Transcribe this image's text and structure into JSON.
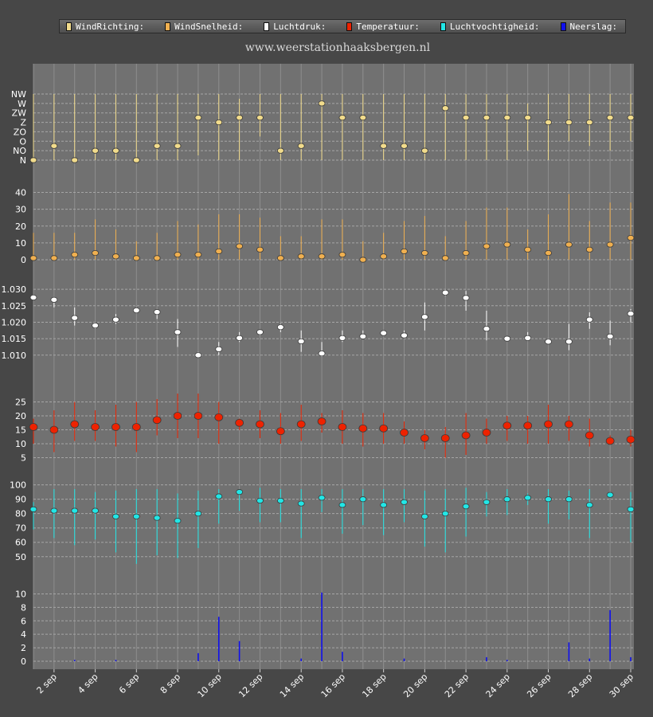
{
  "site_title": "www.weerstationhaaksbergen.nl",
  "legend": [
    {
      "label": "WindRichting:",
      "color": "#f2dc8c"
    },
    {
      "label": "WindSnelheid:",
      "color": "#f0b050"
    },
    {
      "label": "Luchtdruk:",
      "color": "#ffffff"
    },
    {
      "label": "Temperatuur:",
      "color": "#ee2200"
    },
    {
      "label": "Luchtvochtigheid:",
      "color": "#22e6e6"
    },
    {
      "label": "Neerslag:",
      "color": "#1010ee"
    }
  ],
  "chart_data": [
    {
      "type": "scatter",
      "name": "WindRichting",
      "color": "#f2dc8c",
      "days": [
        1,
        2,
        3,
        4,
        5,
        6,
        7,
        8,
        9,
        10,
        11,
        12,
        13,
        14,
        15,
        16,
        17,
        18,
        19,
        20,
        21,
        22,
        23,
        24,
        25,
        26,
        27,
        28,
        29,
        30
      ],
      "yticks": [
        "N",
        "NO",
        "O",
        "ZO",
        "Z",
        "ZW",
        "W",
        "NW"
      ],
      "ylim": [
        0,
        7
      ],
      "values": [
        0,
        1.5,
        0,
        1,
        1,
        0,
        1.5,
        1.5,
        4.5,
        4,
        4.5,
        4.5,
        1,
        1.5,
        6,
        4.5,
        4.5,
        1.5,
        1.5,
        1,
        5.5,
        4.5,
        4.5,
        4.5,
        4.5,
        4,
        4,
        4,
        4.5,
        4.5
      ],
      "low": [
        0,
        0,
        0,
        0,
        0,
        0,
        0,
        0,
        0.5,
        0,
        0,
        2.5,
        0,
        0,
        0,
        0,
        0,
        0,
        0,
        0,
        0,
        0,
        0,
        0,
        1,
        0,
        2,
        1.5,
        1,
        2
      ],
      "high": [
        8,
        8,
        8,
        8,
        8,
        8,
        8,
        8,
        8,
        8,
        6.5,
        8,
        8,
        8,
        8,
        8,
        8,
        8,
        8,
        8,
        8,
        7.5,
        8,
        8,
        6,
        8,
        8,
        8,
        8,
        7
      ]
    },
    {
      "type": "scatter",
      "name": "WindSnelheid",
      "color": "#f0b050",
      "days": [
        1,
        2,
        3,
        4,
        5,
        6,
        7,
        8,
        9,
        10,
        11,
        12,
        13,
        14,
        15,
        16,
        17,
        18,
        19,
        20,
        21,
        22,
        23,
        24,
        25,
        26,
        27,
        28,
        29,
        30
      ],
      "yticks": [
        0,
        10,
        20,
        30,
        40
      ],
      "ylim": [
        0,
        45
      ],
      "values": [
        1,
        1,
        3,
        4,
        2,
        1,
        1,
        3,
        3,
        5,
        8,
        6,
        1,
        2,
        2,
        3,
        0,
        2,
        5,
        4,
        1,
        4,
        8,
        9,
        6,
        4,
        9,
        6,
        9,
        13
      ],
      "low": [
        0,
        0,
        0,
        0,
        0,
        0,
        0,
        0,
        0,
        0,
        0,
        0,
        0,
        0,
        0,
        0,
        0,
        0,
        0,
        0,
        0,
        0,
        0,
        0,
        0,
        0,
        0,
        0,
        0,
        0
      ],
      "high": [
        16,
        16,
        16,
        24,
        18,
        11,
        16,
        23,
        21,
        27,
        27,
        25,
        14,
        14,
        24,
        24,
        11,
        16,
        23,
        26,
        14,
        23,
        31,
        31,
        18,
        27,
        39,
        23,
        34,
        34
      ]
    },
    {
      "type": "scatter",
      "name": "Luchtdruk",
      "color": "#ffffff",
      "days": [
        1,
        2,
        3,
        4,
        5,
        6,
        7,
        8,
        9,
        10,
        11,
        12,
        13,
        14,
        15,
        16,
        17,
        18,
        19,
        20,
        21,
        22,
        23,
        24,
        25,
        26,
        27,
        28,
        29,
        30
      ],
      "yticks": [
        1.01,
        1.015,
        1.02,
        1.025,
        1.03
      ],
      "ylim": [
        1.0085,
        1.031
      ],
      "values": [
        1.0275,
        1.0268,
        1.0213,
        1.019,
        1.0208,
        1.0236,
        1.0231,
        1.017,
        1.01,
        1.0118,
        1.0152,
        1.017,
        1.0185,
        1.0142,
        1.0105,
        1.0152,
        1.0157,
        1.0167,
        1.016,
        1.0216,
        1.029,
        1.0274,
        1.018,
        1.015,
        1.0152,
        1.0141,
        1.0141,
        1.0208,
        1.0157,
        1.0226
      ],
      "low": [
        1.027,
        1.0245,
        1.019,
        1.018,
        1.0195,
        1.023,
        1.021,
        1.0125,
        1.0095,
        1.01,
        1.014,
        1.016,
        1.017,
        1.011,
        1.0095,
        1.014,
        1.015,
        1.016,
        1.0155,
        1.0175,
        1.028,
        1.0235,
        1.0145,
        1.0145,
        1.0145,
        1.0135,
        1.0115,
        1.018,
        1.013,
        1.02
      ],
      "high": [
        1.028,
        1.0275,
        1.0245,
        1.0195,
        1.0225,
        1.0245,
        1.024,
        1.021,
        1.011,
        1.014,
        1.017,
        1.0175,
        1.0195,
        1.0175,
        1.014,
        1.0175,
        1.0175,
        1.0175,
        1.0175,
        1.026,
        1.03,
        1.0295,
        1.0235,
        1.0155,
        1.017,
        1.015,
        1.0195,
        1.023,
        1.0205,
        1.024
      ]
    },
    {
      "type": "scatter",
      "name": "Temperatuur",
      "color": "#ee2200",
      "days": [
        1,
        2,
        3,
        4,
        5,
        6,
        7,
        8,
        9,
        10,
        11,
        12,
        13,
        14,
        15,
        16,
        17,
        18,
        19,
        20,
        21,
        22,
        23,
        24,
        25,
        26,
        27,
        28,
        29,
        30
      ],
      "yticks": [
        5,
        10,
        15,
        20,
        25
      ],
      "ylim": [
        2,
        28
      ],
      "values": [
        16,
        15,
        17,
        16,
        16,
        16,
        18.5,
        20,
        20,
        19.5,
        17.5,
        17,
        14.5,
        17,
        18,
        16,
        15.5,
        15.5,
        14,
        12,
        12,
        13,
        14,
        16.5,
        16.5,
        17,
        17,
        13,
        11,
        11.5
      ],
      "low": [
        10,
        7,
        11,
        11,
        9,
        7,
        13,
        12,
        12,
        10,
        15,
        12,
        10,
        11,
        14,
        10,
        9,
        10,
        10,
        8,
        5,
        6,
        10,
        11,
        10,
        10,
        11,
        9,
        10,
        9
      ],
      "high": [
        19,
        22,
        25,
        22,
        24,
        25,
        26,
        28,
        28,
        25,
        19,
        22,
        21,
        24,
        21,
        22,
        21,
        21,
        18,
        15,
        16,
        21,
        19,
        20,
        20,
        24,
        20,
        19,
        13,
        15
      ]
    },
    {
      "type": "scatter",
      "name": "Luchtvochtigheid",
      "color": "#22e6e6",
      "days": [
        1,
        2,
        3,
        4,
        5,
        6,
        7,
        8,
        9,
        10,
        11,
        12,
        13,
        14,
        15,
        16,
        17,
        18,
        19,
        20,
        21,
        22,
        23,
        24,
        25,
        26,
        27,
        28,
        29,
        30
      ],
      "yticks": [
        50,
        60,
        70,
        80,
        90,
        100
      ],
      "ylim": [
        41,
        102
      ],
      "values": [
        83,
        82,
        82,
        82,
        78,
        78,
        77,
        75,
        80,
        92,
        95,
        89,
        89,
        87,
        91,
        86,
        90,
        86,
        88,
        78,
        80,
        85,
        88,
        90,
        91,
        90,
        90,
        86,
        93,
        83
      ],
      "low": [
        69,
        63,
        58,
        62,
        53,
        45,
        51,
        49,
        56,
        73,
        82,
        74,
        74,
        63,
        81,
        66,
        72,
        65,
        74,
        57,
        53,
        64,
        78,
        79,
        86,
        73,
        76,
        63,
        91,
        60
      ],
      "high": [
        88,
        97,
        97,
        95,
        96,
        97,
        97,
        94,
        96,
        97,
        97,
        98,
        97,
        97,
        97,
        97,
        97,
        97,
        97,
        96,
        97,
        98,
        95,
        97,
        94,
        97,
        96,
        97,
        95,
        95
      ]
    },
    {
      "type": "bar",
      "name": "Neerslag",
      "color": "#1010ee",
      "days": [
        1,
        2,
        3,
        4,
        5,
        6,
        7,
        8,
        9,
        10,
        11,
        12,
        13,
        14,
        15,
        16,
        17,
        18,
        19,
        20,
        21,
        22,
        23,
        24,
        25,
        26,
        27,
        28,
        29,
        30
      ],
      "yticks": [
        0,
        2,
        4,
        6,
        8,
        10
      ],
      "ylim": [
        0,
        11
      ],
      "values": [
        0,
        0,
        0.2,
        0,
        0.2,
        0,
        0,
        0,
        1.2,
        6.6,
        3,
        0,
        0,
        0.4,
        10.2,
        1.4,
        0,
        0,
        0.4,
        0,
        0,
        0,
        0.6,
        0.2,
        0,
        0,
        2.8,
        0.4,
        7.6,
        0.6
      ]
    }
  ],
  "x_axis": {
    "tick_days": [
      2,
      4,
      6,
      8,
      10,
      12,
      14,
      16,
      18,
      20,
      22,
      24,
      26,
      28,
      30
    ],
    "tick_labels": [
      "2 sep",
      "4 sep",
      "6 sep",
      "8 sep",
      "10 sep",
      "12 sep",
      "14 sep",
      "16 sep",
      "18 sep",
      "20 sep",
      "22 sep",
      "24 sep",
      "26 sep",
      "28 sep",
      "30 sep"
    ],
    "range": [
      1,
      30
    ]
  }
}
